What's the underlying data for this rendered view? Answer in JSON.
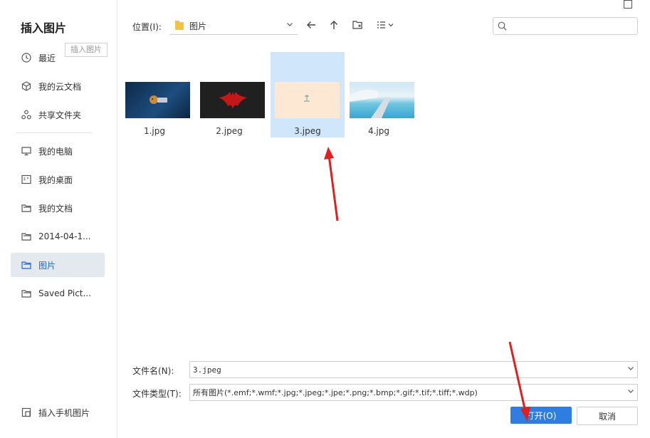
{
  "dialog": {
    "title": "插入图片",
    "tooltip": "插入图片"
  },
  "sidebar": {
    "items": [
      {
        "label": "最近",
        "icon": "clock-icon"
      },
      {
        "label": "我的云文档",
        "icon": "cloud-doc-icon"
      },
      {
        "label": "共享文件夹",
        "icon": "share-icon"
      },
      {
        "label": "我的电脑",
        "icon": "computer-icon"
      },
      {
        "label": "我的桌面",
        "icon": "desktop-icon"
      },
      {
        "label": "我的文档",
        "icon": "folder-icon"
      },
      {
        "label": "2014-04-1...",
        "icon": "folder-icon"
      },
      {
        "label": "图片",
        "icon": "folder-icon",
        "active": true
      },
      {
        "label": "Saved Pict...",
        "icon": "folder-icon"
      }
    ],
    "bottom_item": {
      "label": "插入手机图片",
      "icon": "phone-image-icon"
    }
  },
  "toolbar": {
    "location_label": "位置(I):",
    "location_value": "图片",
    "search_placeholder": ""
  },
  "files": [
    {
      "name": "1.jpg"
    },
    {
      "name": "2.jpeg"
    },
    {
      "name": "3.jpeg",
      "selected": true
    },
    {
      "name": "4.jpg"
    }
  ],
  "form": {
    "filename_label": "文件名(N):",
    "filename_value": "3.jpeg",
    "filetype_label": "文件类型(T):",
    "filetype_value": "所有图片(*.emf;*.wmf;*.jpg;*.jpeg;*.jpe;*.png;*.bmp;*.gif;*.tif;*.tiff;*.wdp)"
  },
  "buttons": {
    "open": "打开(O)",
    "cancel": "取消"
  },
  "colors": {
    "accent": "#2f7de1",
    "selection": "#cfe6fb",
    "annotation": "#e02020"
  }
}
